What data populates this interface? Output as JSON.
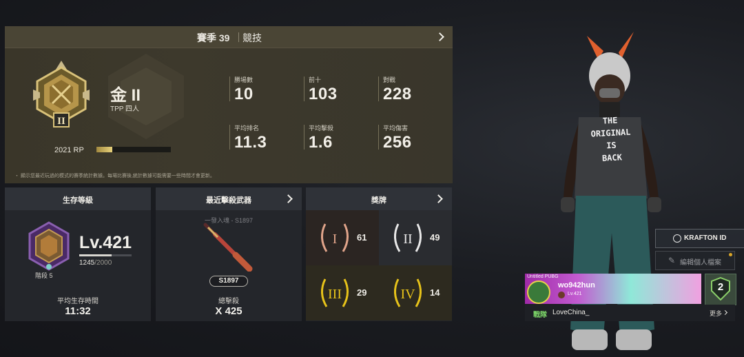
{
  "season": {
    "season_label": "賽季 39",
    "mode_label": "競技",
    "rank_name": "金 II",
    "rank_mode": "TPP 四人",
    "rp": "2021 RP",
    "rp_progress": 0.21,
    "note": "・ 顯示您最近玩過的模式的賽季統計數據。每場比賽後,統計數據可能需要一些時間才會更新。",
    "stats": [
      {
        "label": "勝場數",
        "value": "10"
      },
      {
        "label": "前十",
        "value": "103"
      },
      {
        "label": "對戰",
        "value": "228"
      },
      {
        "label": "平均排名",
        "value": "11.3"
      },
      {
        "label": "平均擊殺",
        "value": "1.6"
      },
      {
        "label": "平均傷害",
        "value": "256"
      }
    ]
  },
  "survival": {
    "title": "生存等級",
    "level": "Lv.421",
    "xp": "1245",
    "xp_max": "/2000",
    "xp_progress": 0.62,
    "tier": "階段 5",
    "avg_time_label": "平均生存時間",
    "avg_time": "11:32"
  },
  "weapon": {
    "title": "最近擊殺武器",
    "sub": "一發入魂 - S1897",
    "name": "S1897",
    "kills_label": "總擊殺",
    "kills": "X 425"
  },
  "medals": {
    "title": "獎牌",
    "items": [
      {
        "numeral": "I",
        "count": "61",
        "color": "#e0a48a"
      },
      {
        "numeral": "II",
        "count": "49",
        "color": "#e8e8e8"
      },
      {
        "numeral": "III",
        "count": "29",
        "color": "#e6c21a"
      },
      {
        "numeral": "IV",
        "count": "14",
        "color": "#e6c21a"
      }
    ]
  },
  "profile": {
    "krafton_label": "KRAFTON ID",
    "edit_label": "編輯個人檔案",
    "banner_top": "Untitled PUBG",
    "player_name": "wo942hun",
    "player_sub": "Lv.421",
    "clan_number": "2",
    "clan_label": "戰隊",
    "clan_name": "LoveChina_",
    "more_label": "更多",
    "shirt_lines": [
      "THE",
      "ORIGINAL",
      "IS",
      "BACK"
    ]
  }
}
